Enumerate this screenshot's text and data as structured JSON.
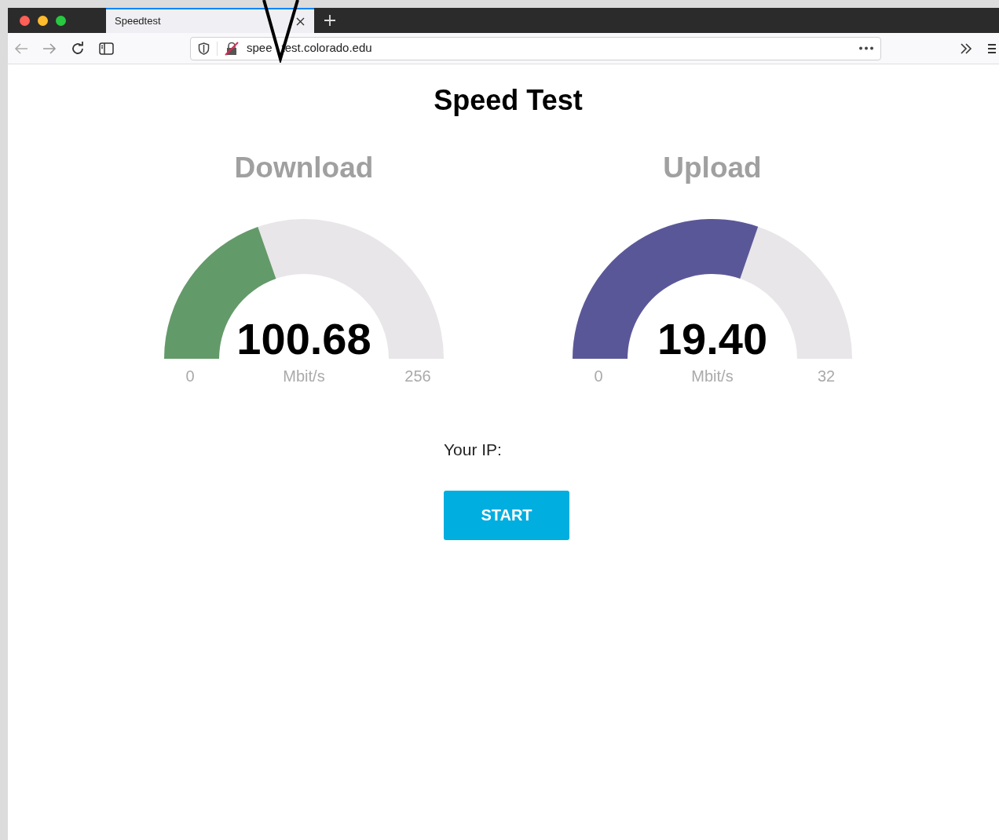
{
  "browser": {
    "tab": {
      "title": "Speedtest",
      "selected": true
    },
    "url_parts": [
      "spee",
      "test.colorado.edu"
    ]
  },
  "page": {
    "title": "Speed Test",
    "gauges": [
      {
        "label": "Download",
        "value": "100.68",
        "unit": "Mbit/s",
        "min": "0",
        "max": "256",
        "level": 0.393,
        "color": "#639a69"
      },
      {
        "label": "Upload",
        "value": "19.40",
        "unit": "Mbit/s",
        "min": "0",
        "max": "32",
        "level": 0.606,
        "color": "#5a5799"
      }
    ],
    "ip_label": "Your IP:",
    "start_button": "START"
  }
}
